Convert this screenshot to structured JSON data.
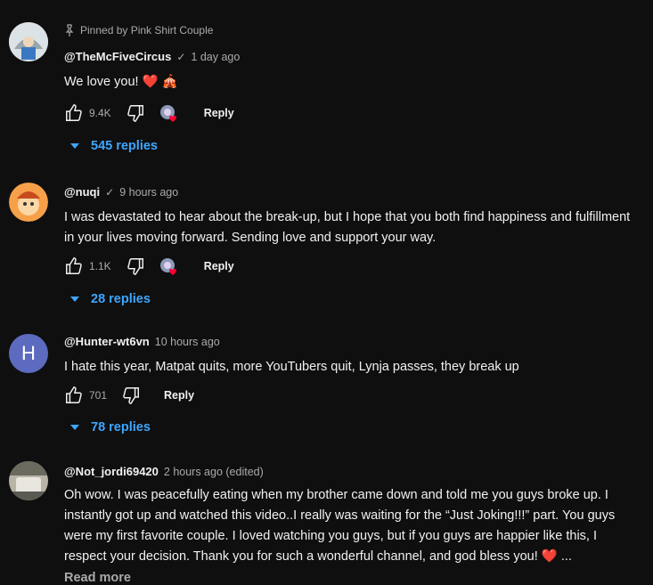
{
  "comments": [
    {
      "pinned_text": "Pinned by Pink Shirt Couple",
      "author": "@TheMcFiveCircus",
      "time": "1 day ago",
      "text": "We love you! ❤️ 🎪",
      "likes": "9.4K",
      "reply_label": "Reply",
      "replies": "545 replies",
      "avatar_color": "#cfd8dc"
    },
    {
      "author": "@nuqi",
      "time": "9 hours ago",
      "text": "I was devastated to hear about the break-up, but I hope that you both find happiness and fulfillment in your lives moving forward. Sending love and support your way.",
      "likes": "1.1K",
      "reply_label": "Reply",
      "replies": "28 replies",
      "avatar_color": "#f7a04a"
    },
    {
      "author": "@Hunter-wt6vn",
      "time": "10 hours ago",
      "text": "I hate this year, Matpat quits, more YouTubers quit, Lynja passes, they break up",
      "likes": "701",
      "reply_label": "Reply",
      "replies": "78 replies",
      "avatar_letter": "H",
      "avatar_color": "#5c6bc0"
    },
    {
      "author": "@Not_jordi69420",
      "time": "2 hours ago (edited)",
      "text": "Oh wow. I was peacefully eating when my brother came down and told me you guys broke up. I instantly got up and watched this video..I really was waiting for the “Just Joking!!!” part. You guys were my first favorite couple. I loved watching you guys, but if you guys are happier like this, I respect your decision. Thank you for such a wonderful channel, and god bless you! ❤️ ...",
      "read_more": "Read more",
      "avatar_color": "#8d8d84"
    }
  ],
  "colors": {
    "background": "#0f0f0f",
    "link": "#3ea6ff",
    "muted": "#aaaaaa",
    "heart": "#ff0033"
  },
  "icons": [
    "pin-icon",
    "verified-check-icon",
    "thumbs-up-icon",
    "thumbs-down-icon",
    "creator-heart-icon",
    "caret-down-icon"
  ]
}
